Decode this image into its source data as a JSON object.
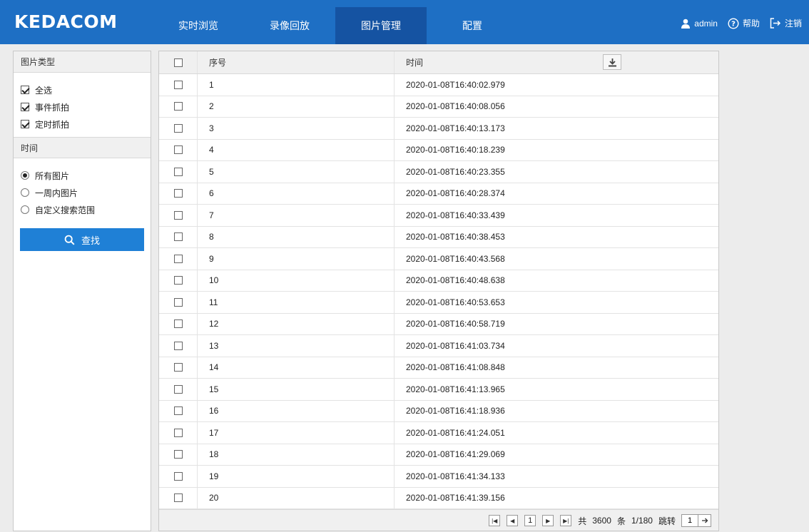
{
  "header": {
    "logo": "KEDACOM",
    "nav": [
      {
        "label": "实时浏览",
        "active": false
      },
      {
        "label": "录像回放",
        "active": false
      },
      {
        "label": "图片管理",
        "active": true
      },
      {
        "label": "配置",
        "active": false
      }
    ],
    "user": "admin",
    "help": "帮助",
    "logout": "注销",
    "icons": {
      "user": "user-icon",
      "help": "help-icon",
      "logout": "logout-icon"
    },
    "colors": {
      "bar": "#1e6fc4",
      "active_tab": "#1553a2"
    }
  },
  "left_panel": {
    "type_title": "图片类型",
    "types": [
      {
        "label": "全选",
        "checked": true
      },
      {
        "label": "事件抓拍",
        "checked": true
      },
      {
        "label": "定时抓拍",
        "checked": true
      }
    ],
    "time_title": "时间",
    "time_options": [
      {
        "label": "所有图片",
        "selected": true
      },
      {
        "label": "一周内图片",
        "selected": false
      },
      {
        "label": "自定义搜索范围",
        "selected": false
      }
    ],
    "search_label": "查找",
    "search_icon": "search-icon",
    "button_color": "#1f80d6"
  },
  "table": {
    "headers": {
      "select": "",
      "index": "序号",
      "time": "时间"
    },
    "download_icon": "download-icon",
    "rows": [
      {
        "index": "1",
        "time": "2020-01-08T16:40:02.979"
      },
      {
        "index": "2",
        "time": "2020-01-08T16:40:08.056"
      },
      {
        "index": "3",
        "time": "2020-01-08T16:40:13.173"
      },
      {
        "index": "4",
        "time": "2020-01-08T16:40:18.239"
      },
      {
        "index": "5",
        "time": "2020-01-08T16:40:23.355"
      },
      {
        "index": "6",
        "time": "2020-01-08T16:40:28.374"
      },
      {
        "index": "7",
        "time": "2020-01-08T16:40:33.439"
      },
      {
        "index": "8",
        "time": "2020-01-08T16:40:38.453"
      },
      {
        "index": "9",
        "time": "2020-01-08T16:40:43.568"
      },
      {
        "index": "10",
        "time": "2020-01-08T16:40:48.638"
      },
      {
        "index": "11",
        "time": "2020-01-08T16:40:53.653"
      },
      {
        "index": "12",
        "time": "2020-01-08T16:40:58.719"
      },
      {
        "index": "13",
        "time": "2020-01-08T16:41:03.734"
      },
      {
        "index": "14",
        "time": "2020-01-08T16:41:08.848"
      },
      {
        "index": "15",
        "time": "2020-01-08T16:41:13.965"
      },
      {
        "index": "16",
        "time": "2020-01-08T16:41:18.936"
      },
      {
        "index": "17",
        "time": "2020-01-08T16:41:24.051"
      },
      {
        "index": "18",
        "time": "2020-01-08T16:41:29.069"
      },
      {
        "index": "19",
        "time": "2020-01-08T16:41:34.133"
      },
      {
        "index": "20",
        "time": "2020-01-08T16:41:39.156"
      }
    ]
  },
  "pager": {
    "current_page": "1",
    "total_prefix": "共",
    "total": "3600",
    "total_suffix": "条",
    "page_info": "1/180",
    "jump_label": "跳转",
    "jump_value": "1",
    "icons": [
      "first-page-icon",
      "prev-page-icon",
      "next-page-icon",
      "last-page-icon",
      "go-arrow-icon"
    ]
  }
}
